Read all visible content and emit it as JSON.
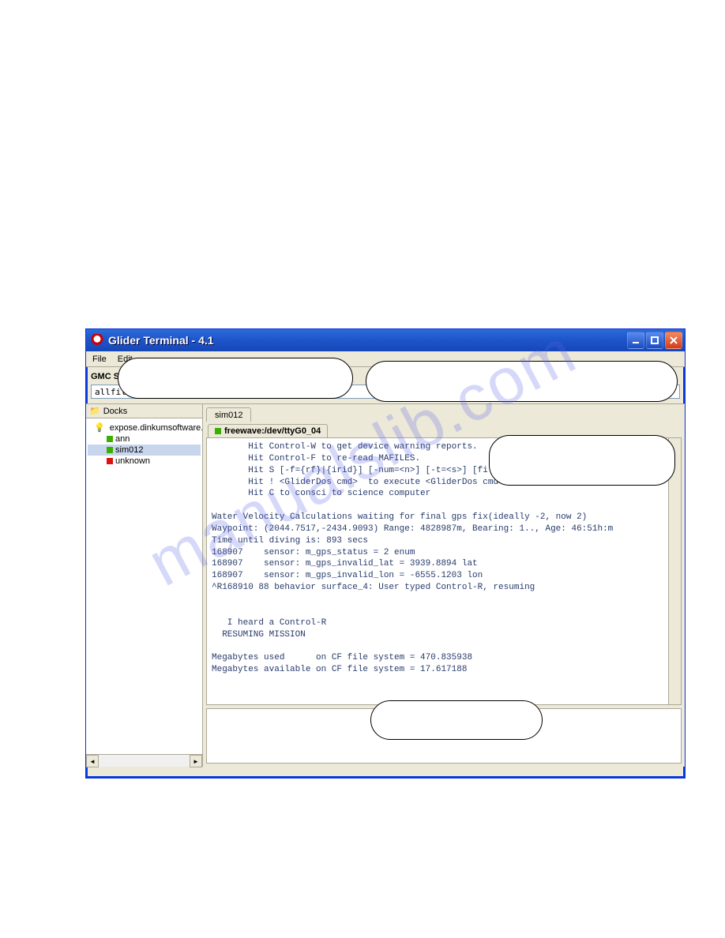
{
  "watermark": "manualslib.com",
  "window": {
    "title": "Glider Terminal - 4.1",
    "menu": {
      "file": "File",
      "edit": "Edit"
    },
    "gmc_label": "GMC S",
    "path_value": "allfilesToDock.xml"
  },
  "sidebar": {
    "header": "Docks",
    "root": "expose.dinkumsoftware.com",
    "items": [
      {
        "label": "ann",
        "color": "green",
        "selected": false
      },
      {
        "label": "sim012",
        "color": "green",
        "selected": true
      },
      {
        "label": "unknown",
        "color": "red",
        "selected": false
      }
    ]
  },
  "tabs": {
    "main_tab": "sim012",
    "sub_tab": "freewave:/dev/ttyG0_04"
  },
  "terminal_lines": [
    "       Hit Control-W to get device warning reports.",
    "       Hit Control-F to re-read MAFILES.",
    "       Hit S [-f={rf}|{irid}] [-num=<n>] [-t=<s>] [filespec ...] to",
    "       Hit ! <GliderDos cmd>  to execute <GliderDos cmd>",
    "       Hit C to consci to science computer",
    "",
    "Water Velocity Calculations waiting for final gps fix(ideally -2, now 2)",
    "Waypoint: (2044.7517,-2434.9093) Range: 4828987m, Bearing: 1.., Age: 46:51h:m",
    "Time until diving is: 893 secs",
    "168907    sensor: m_gps_status = 2 enum",
    "168907    sensor: m_gps_invalid_lat = 3939.8894 lat",
    "168907    sensor: m_gps_invalid_lon = -6555.1203 lon",
    "^R168910 88 behavior surface_4: User typed Control-R, resuming",
    "",
    "",
    "   I heard a Control-R",
    "  RESUMING MISSION",
    "",
    "Megabytes used      on CF file system = 470.835938",
    "Megabytes available on CF file system = 17.617188"
  ]
}
